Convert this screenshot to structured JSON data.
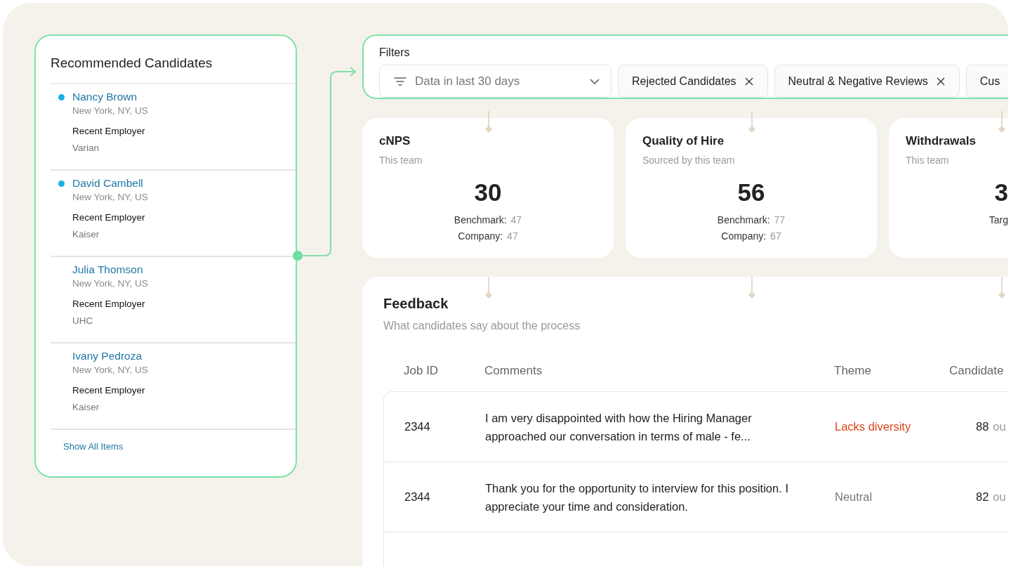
{
  "candidates_panel": {
    "title": "Recommended Candidates",
    "candidates": [
      {
        "name": "Nancy Brown",
        "location": "New York, NY, US",
        "employer_label": "Recent Employer",
        "employer": "Varian",
        "unread": true
      },
      {
        "name": "David Cambell",
        "location": "New York, NY, US",
        "employer_label": "Recent Employer",
        "employer": "Kaiser",
        "unread": true
      },
      {
        "name": "Julia Thomson",
        "location": "New York, NY, US",
        "employer_label": "Recent Employer",
        "employer": "UHC",
        "unread": false
      },
      {
        "name": "Ivany Pedroza",
        "location": "New York, NY, US",
        "employer_label": "Recent Employer",
        "employer": "Kaiser",
        "unread": false
      }
    ],
    "show_all": "Show All Items"
  },
  "filters": {
    "label": "Filters",
    "period": {
      "value": "Data in last 30 days"
    },
    "chips": [
      {
        "label": "Rejected Candidates",
        "removable": true
      },
      {
        "label": "Neutral & Negative Reviews",
        "removable": true
      },
      {
        "label": "Cus"
      }
    ]
  },
  "metrics": [
    {
      "title": "cNPS",
      "subtitle": "This team",
      "value": "30",
      "lines": [
        {
          "label": "Benchmark:",
          "value": "47"
        },
        {
          "label": "Company:",
          "value": "47"
        }
      ]
    },
    {
      "title": "Quality of Hire",
      "subtitle": "Sourced by this team",
      "value": "56",
      "lines": [
        {
          "label": "Benchmark:",
          "value": "77"
        },
        {
          "label": "Company:",
          "value": "67"
        }
      ]
    },
    {
      "title": "Withdrawals",
      "subtitle": "This team",
      "value": "3",
      "lines": [
        {
          "label": "Targ"
        }
      ]
    }
  ],
  "feedback": {
    "title": "Feedback",
    "subtitle": "What candidates say about the process",
    "columns": [
      "Job ID",
      "Comments",
      "Theme",
      "Candidate"
    ],
    "rows": [
      {
        "job_id": "2344",
        "comment": "I am very disappointed with how the Hiring Manager approached our conversation in terms of male - fe...",
        "theme": "Lacks diversity",
        "color": "#d9441c",
        "score": "88",
        "score_suffix": "ou"
      },
      {
        "job_id": "2344",
        "comment": "Thank you for the opportunity to interview for this position. I appreciate your time and consideration.",
        "theme": "Neutral",
        "color": "#777777",
        "score": "82",
        "score_suffix": "ou"
      }
    ]
  }
}
